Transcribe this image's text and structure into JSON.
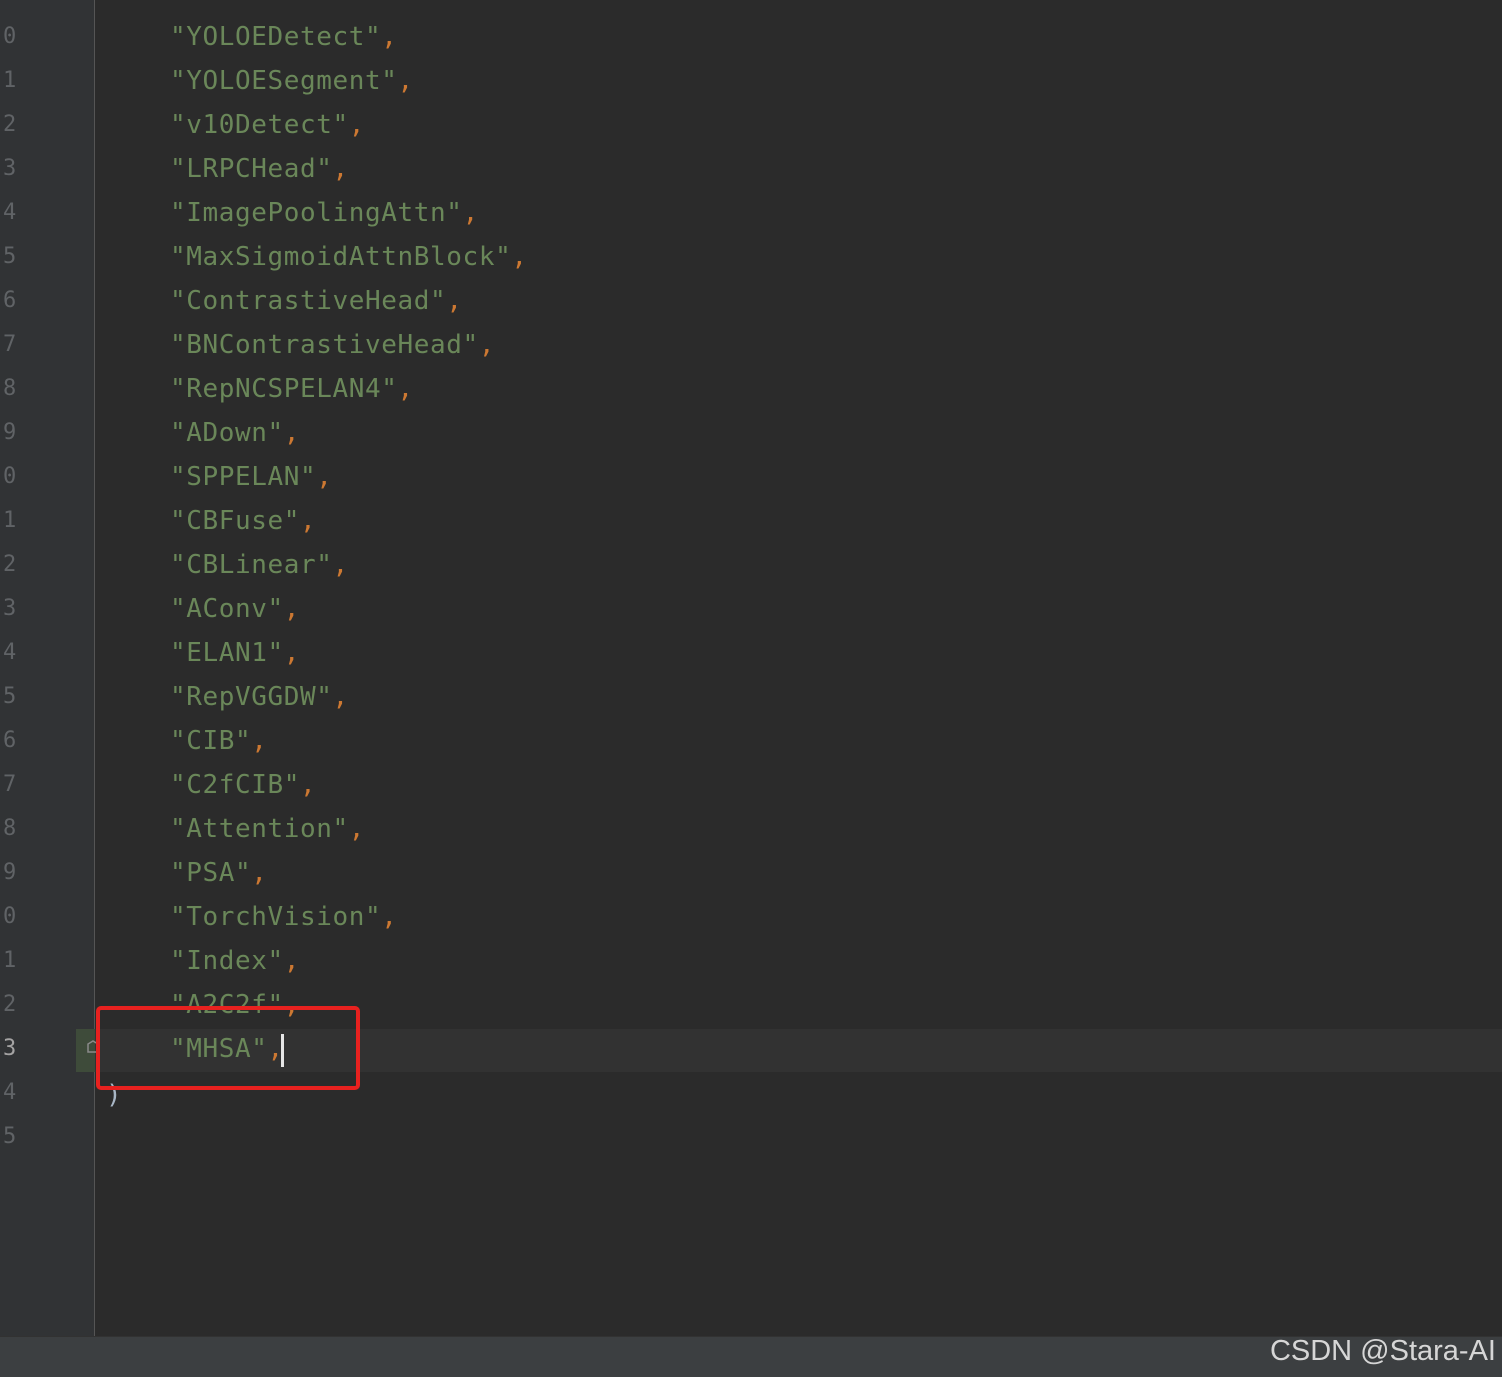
{
  "editor": {
    "line_numbers": [
      "0",
      "1",
      "2",
      "3",
      "4",
      "5",
      "6",
      "7",
      "8",
      "9",
      "0",
      "1",
      "2",
      "3",
      "4",
      "5",
      "6",
      "7",
      "8",
      "9",
      "0",
      "1",
      "2",
      "3",
      "4",
      "5"
    ],
    "active_line_index": 23,
    "lines": [
      {
        "text": "\"YOLOEDetect\"",
        "punct": ","
      },
      {
        "text": "\"YOLOESegment\"",
        "punct": ","
      },
      {
        "text": "\"v10Detect\"",
        "punct": ","
      },
      {
        "text": "\"LRPCHead\"",
        "punct": ","
      },
      {
        "text": "\"ImagePoolingAttn\"",
        "punct": ","
      },
      {
        "text": "\"MaxSigmoidAttnBlock\"",
        "punct": ","
      },
      {
        "text": "\"ContrastiveHead\"",
        "punct": ","
      },
      {
        "text": "\"BNContrastiveHead\"",
        "punct": ","
      },
      {
        "text": "\"RepNCSPELAN4\"",
        "punct": ","
      },
      {
        "text": "\"ADown\"",
        "punct": ","
      },
      {
        "text": "\"SPPELAN\"",
        "punct": ","
      },
      {
        "text": "\"CBFuse\"",
        "punct": ","
      },
      {
        "text": "\"CBLinear\"",
        "punct": ","
      },
      {
        "text": "\"AConv\"",
        "punct": ","
      },
      {
        "text": "\"ELAN1\"",
        "punct": ","
      },
      {
        "text": "\"RepVGGDW\"",
        "punct": ","
      },
      {
        "text": "\"CIB\"",
        "punct": ","
      },
      {
        "text": "\"C2fCIB\"",
        "punct": ","
      },
      {
        "text": "\"Attention\"",
        "punct": ","
      },
      {
        "text": "\"PSA\"",
        "punct": ","
      },
      {
        "text": "\"TorchVision\"",
        "punct": ","
      },
      {
        "text": "\"Index\"",
        "punct": ","
      },
      {
        "text": "\"A2C2f\"",
        "punct": ","
      },
      {
        "text": "\"MHSA\"",
        "punct": ","
      }
    ],
    "closing_brace": ")"
  },
  "watermark": "CSDN @Stara-AI",
  "colors": {
    "background": "#2b2b2b",
    "string": "#6a8759",
    "punctuation": "#cc7832",
    "line_number": "#606366",
    "highlight_box": "#e8211f"
  }
}
